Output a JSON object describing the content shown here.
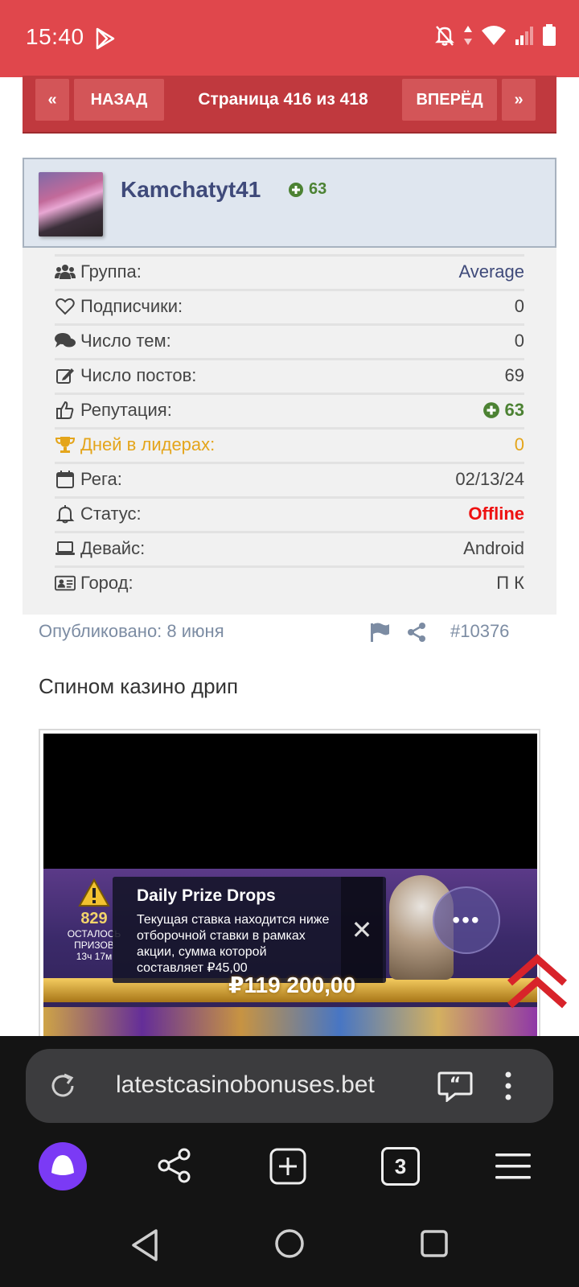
{
  "status_bar": {
    "time": "15:40"
  },
  "pager": {
    "first": "«",
    "prev": "НАЗАД",
    "label": "Страница 416 из 418",
    "next": "ВПЕРЁД",
    "last": "»"
  },
  "profile": {
    "username": "Kamchatyt41",
    "reputation": "63"
  },
  "stats": [
    {
      "label": "Группа:",
      "value": "Average",
      "icon": "users-icon"
    },
    {
      "label": "Подписчики:",
      "value": "0",
      "icon": "heart-icon"
    },
    {
      "label": "Число тем:",
      "value": "0",
      "icon": "comments-icon"
    },
    {
      "label": "Число постов:",
      "value": "69",
      "icon": "edit-icon"
    },
    {
      "label": "Репутация:",
      "value": "63",
      "icon": "thumbs-up-icon"
    },
    {
      "label": "Дней в лидерах:",
      "value": "0",
      "icon": "trophy-icon"
    },
    {
      "label": "Рега:",
      "value": "02/13/24",
      "icon": "calendar-icon"
    },
    {
      "label": "Статус:",
      "value": "Offline",
      "icon": "bell-icon"
    },
    {
      "label": "Девайс:",
      "value": "Android",
      "icon": "laptop-icon"
    },
    {
      "label": "Город:",
      "value": "П К",
      "icon": "id-card-icon"
    }
  ],
  "post": {
    "published": "Опубликовано: 8 июня",
    "number": "#10376",
    "text": "Спином казино дрип"
  },
  "embed": {
    "prizes_count": "829",
    "prizes_label": "ОСТАЛОСЬ ПРИЗОВ",
    "prizes_timer": "13ч 17м",
    "popup_title": "Daily Prize Drops",
    "popup_body": "Текущая ставка находится ниже отборочной ставки в рамках акции, сумма которой составляет ₽45,00",
    "jackpot": "₽119 200,00"
  },
  "browser": {
    "url": "latestcasinobonuses.bet",
    "tab_count": "3"
  },
  "colors": {
    "status_bar": "#e0474c",
    "pager": "#c0393e",
    "username": "#3f4a7a",
    "reputation": "#4c8233",
    "leader": "#e4a51b",
    "offline": "#ee1111"
  }
}
